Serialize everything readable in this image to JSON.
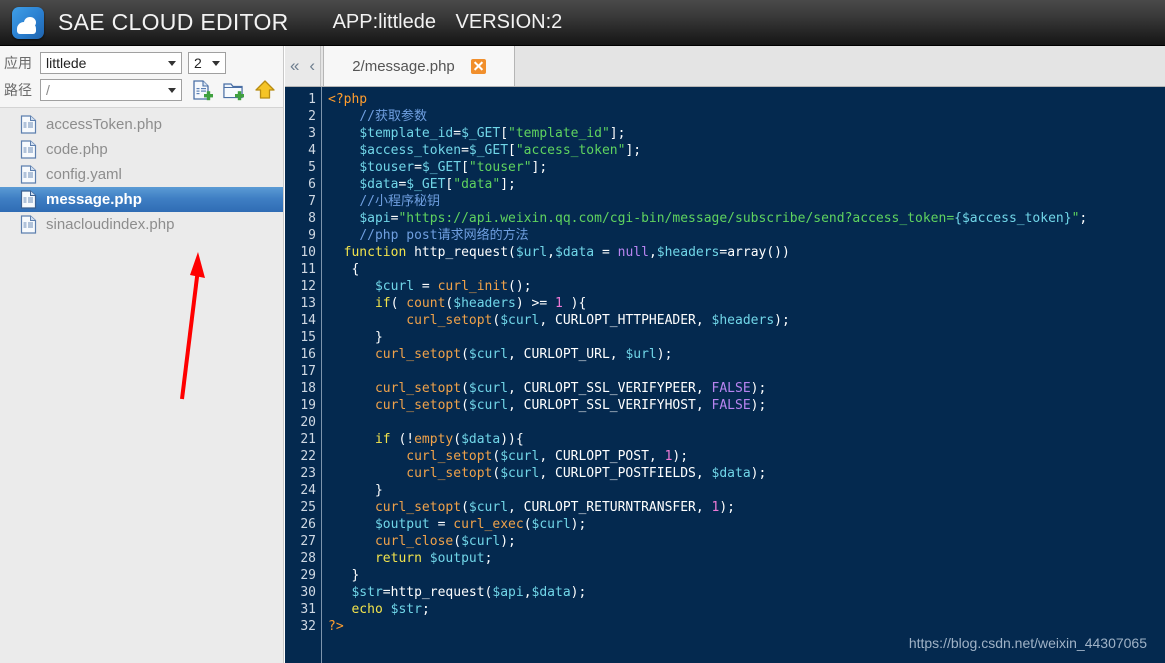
{
  "header": {
    "product_title": "SAE CLOUD EDITOR",
    "app_label": "APP:littlede",
    "version_label": "VERSION:2",
    "logo_icon": "cloud-logo-icon"
  },
  "sidebar": {
    "app_row": {
      "label": "应用",
      "app_select_value": "littlede",
      "version_select_value": "2"
    },
    "path_row": {
      "label": "路径",
      "path_select_value": "/"
    },
    "toolbar": [
      {
        "name": "new-file-icon",
        "title": "new file"
      },
      {
        "name": "new-folder-icon",
        "title": "new folder"
      },
      {
        "name": "upload-icon",
        "title": "upload"
      }
    ],
    "files": [
      {
        "name": "accessToken.php",
        "selected": false
      },
      {
        "name": "code.php",
        "selected": false
      },
      {
        "name": "config.yaml",
        "selected": false
      },
      {
        "name": "message.php",
        "selected": true
      },
      {
        "name": "sinacloudindex.php",
        "selected": false
      }
    ]
  },
  "tabbar": {
    "nav_first": "«",
    "nav_prev": "‹",
    "tabs": [
      {
        "label": "2/message.php",
        "active": true,
        "close_icon": "close-icon"
      }
    ]
  },
  "editor": {
    "line_count": 32,
    "lines": [
      [
        [
          "<?php",
          "t-tag"
        ]
      ],
      [
        [
          "    ",
          ""
        ],
        [
          "//获取参数",
          "t-cmt"
        ]
      ],
      [
        [
          "    ",
          ""
        ],
        [
          "$template_id",
          "t-var"
        ],
        [
          "=",
          "t-plain"
        ],
        [
          "$_GET",
          "t-var"
        ],
        [
          "[",
          "t-plain"
        ],
        [
          "\"template_id\"",
          "t-str"
        ],
        [
          "];",
          "t-plain"
        ]
      ],
      [
        [
          "    ",
          ""
        ],
        [
          "$access_token",
          "t-var"
        ],
        [
          "=",
          "t-plain"
        ],
        [
          "$_GET",
          "t-var"
        ],
        [
          "[",
          "t-plain"
        ],
        [
          "\"access_token\"",
          "t-str"
        ],
        [
          "];",
          "t-plain"
        ]
      ],
      [
        [
          "    ",
          ""
        ],
        [
          "$touser",
          "t-var"
        ],
        [
          "=",
          "t-plain"
        ],
        [
          "$_GET",
          "t-var"
        ],
        [
          "[",
          "t-plain"
        ],
        [
          "\"touser\"",
          "t-str"
        ],
        [
          "];",
          "t-plain"
        ]
      ],
      [
        [
          "    ",
          ""
        ],
        [
          "$data",
          "t-var"
        ],
        [
          "=",
          "t-plain"
        ],
        [
          "$_GET",
          "t-var"
        ],
        [
          "[",
          "t-plain"
        ],
        [
          "\"data\"",
          "t-str"
        ],
        [
          "];",
          "t-plain"
        ]
      ],
      [
        [
          "    ",
          ""
        ],
        [
          "//小程序秘钥",
          "t-cmt"
        ]
      ],
      [
        [
          "    ",
          ""
        ],
        [
          "$api",
          "t-var"
        ],
        [
          "=",
          "t-plain"
        ],
        [
          "\"https://api.weixin.qq.com/cgi-bin/message/subscribe/send?access_token=",
          "t-str"
        ],
        [
          "{$access_token}",
          "t-var"
        ],
        [
          "\"",
          "t-str"
        ],
        [
          ";",
          "t-plain"
        ]
      ],
      [
        [
          "    ",
          ""
        ],
        [
          "//php post请求网络的方法",
          "t-cmt"
        ]
      ],
      [
        [
          "  ",
          ""
        ],
        [
          "function",
          "t-kw"
        ],
        [
          " http_request(",
          "t-plain"
        ],
        [
          "$url",
          "t-var"
        ],
        [
          ",",
          "t-plain"
        ],
        [
          "$data",
          "t-var"
        ],
        [
          " = ",
          "t-plain"
        ],
        [
          "null",
          "t-null"
        ],
        [
          ",",
          "t-plain"
        ],
        [
          "$headers",
          "t-var"
        ],
        [
          "=array())",
          "t-plain"
        ]
      ],
      [
        [
          "   {",
          "t-plain"
        ]
      ],
      [
        [
          "      ",
          ""
        ],
        [
          "$curl",
          "t-var"
        ],
        [
          " = ",
          "t-plain"
        ],
        [
          "curl_init",
          "t-fn"
        ],
        [
          "();",
          "t-plain"
        ]
      ],
      [
        [
          "      ",
          ""
        ],
        [
          "if",
          "t-kw"
        ],
        [
          "( ",
          "t-plain"
        ],
        [
          "count",
          "t-fn"
        ],
        [
          "(",
          "t-plain"
        ],
        [
          "$headers",
          "t-var"
        ],
        [
          ") >= ",
          "t-plain"
        ],
        [
          "1",
          "t-num"
        ],
        [
          " ){",
          "t-plain"
        ]
      ],
      [
        [
          "          ",
          ""
        ],
        [
          "curl_setopt",
          "t-fn"
        ],
        [
          "(",
          "t-plain"
        ],
        [
          "$curl",
          "t-var"
        ],
        [
          ", CURLOPT_HTTPHEADER, ",
          "t-plain"
        ],
        [
          "$headers",
          "t-var"
        ],
        [
          ");",
          "t-plain"
        ]
      ],
      [
        [
          "      }",
          "t-plain"
        ]
      ],
      [
        [
          "      ",
          ""
        ],
        [
          "curl_setopt",
          "t-fn"
        ],
        [
          "(",
          "t-plain"
        ],
        [
          "$curl",
          "t-var"
        ],
        [
          ", CURLOPT_URL, ",
          "t-plain"
        ],
        [
          "$url",
          "t-var"
        ],
        [
          ");",
          "t-plain"
        ]
      ],
      [
        [
          "",
          ""
        ]
      ],
      [
        [
          "      ",
          ""
        ],
        [
          "curl_setopt",
          "t-fn"
        ],
        [
          "(",
          "t-plain"
        ],
        [
          "$curl",
          "t-var"
        ],
        [
          ", CURLOPT_SSL_VERIFYPEER, ",
          "t-plain"
        ],
        [
          "FALSE",
          "t-const"
        ],
        [
          ");",
          "t-plain"
        ]
      ],
      [
        [
          "      ",
          ""
        ],
        [
          "curl_setopt",
          "t-fn"
        ],
        [
          "(",
          "t-plain"
        ],
        [
          "$curl",
          "t-var"
        ],
        [
          ", CURLOPT_SSL_VERIFYHOST, ",
          "t-plain"
        ],
        [
          "FALSE",
          "t-const"
        ],
        [
          ");",
          "t-plain"
        ]
      ],
      [
        [
          "",
          ""
        ]
      ],
      [
        [
          "      ",
          ""
        ],
        [
          "if",
          "t-kw"
        ],
        [
          " (!",
          "t-plain"
        ],
        [
          "empty",
          "t-fn"
        ],
        [
          "(",
          "t-plain"
        ],
        [
          "$data",
          "t-var"
        ],
        [
          ")){",
          "t-plain"
        ]
      ],
      [
        [
          "          ",
          ""
        ],
        [
          "curl_setopt",
          "t-fn"
        ],
        [
          "(",
          "t-plain"
        ],
        [
          "$curl",
          "t-var"
        ],
        [
          ", CURLOPT_POST, ",
          "t-plain"
        ],
        [
          "1",
          "t-num"
        ],
        [
          ");",
          "t-plain"
        ]
      ],
      [
        [
          "          ",
          ""
        ],
        [
          "curl_setopt",
          "t-fn"
        ],
        [
          "(",
          "t-plain"
        ],
        [
          "$curl",
          "t-var"
        ],
        [
          ", CURLOPT_POSTFIELDS, ",
          "t-plain"
        ],
        [
          "$data",
          "t-var"
        ],
        [
          ");",
          "t-plain"
        ]
      ],
      [
        [
          "      }",
          "t-plain"
        ]
      ],
      [
        [
          "      ",
          ""
        ],
        [
          "curl_setopt",
          "t-fn"
        ],
        [
          "(",
          "t-plain"
        ],
        [
          "$curl",
          "t-var"
        ],
        [
          ", CURLOPT_RETURNTRANSFER, ",
          "t-plain"
        ],
        [
          "1",
          "t-num"
        ],
        [
          ");",
          "t-plain"
        ]
      ],
      [
        [
          "      ",
          ""
        ],
        [
          "$output",
          "t-var"
        ],
        [
          " = ",
          "t-plain"
        ],
        [
          "curl_exec",
          "t-fn"
        ],
        [
          "(",
          "t-plain"
        ],
        [
          "$curl",
          "t-var"
        ],
        [
          ");",
          "t-plain"
        ]
      ],
      [
        [
          "      ",
          ""
        ],
        [
          "curl_close",
          "t-fn"
        ],
        [
          "(",
          "t-plain"
        ],
        [
          "$curl",
          "t-var"
        ],
        [
          ");",
          "t-plain"
        ]
      ],
      [
        [
          "      ",
          ""
        ],
        [
          "return",
          "t-ret"
        ],
        [
          " ",
          "t-plain"
        ],
        [
          "$output",
          "t-var"
        ],
        [
          ";",
          "t-plain"
        ]
      ],
      [
        [
          "   }",
          "t-plain"
        ]
      ],
      [
        [
          "   ",
          ""
        ],
        [
          "$str",
          "t-var"
        ],
        [
          "=http_request(",
          "t-plain"
        ],
        [
          "$api",
          "t-var"
        ],
        [
          ",",
          "t-plain"
        ],
        [
          "$data",
          "t-var"
        ],
        [
          ");",
          "t-plain"
        ]
      ],
      [
        [
          "   ",
          ""
        ],
        [
          "echo",
          "t-kw"
        ],
        [
          " ",
          "t-plain"
        ],
        [
          "$str",
          "t-var"
        ],
        [
          ";",
          "t-plain"
        ]
      ],
      [
        [
          "?>",
          "t-tag"
        ]
      ]
    ]
  },
  "watermark": {
    "text": "https://blog.csdn.net/weixin_44307065"
  },
  "annotation": {
    "arrow_color": "#ff0000",
    "points_at": "message.php"
  },
  "colors": {
    "header_bg": "#2b2b2b",
    "editor_bg": "#04294f",
    "sidebar_bg": "#ebebeb",
    "selection_blue": "#3f7fc4",
    "tab_close_orange": "#f18f2c"
  }
}
